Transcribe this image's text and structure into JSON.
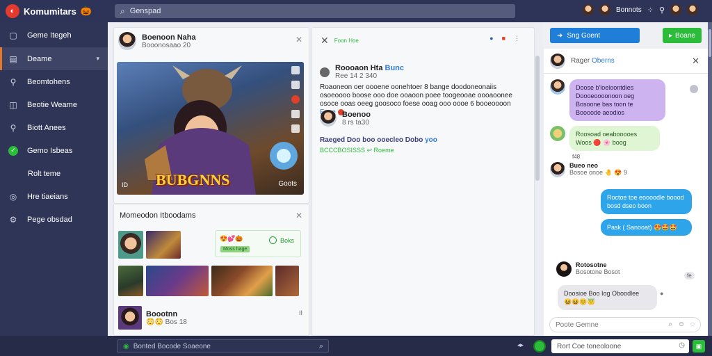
{
  "app": {
    "name": "Komumitars",
    "logo_emoji": "🎃"
  },
  "search": {
    "placeholder": "Genspad"
  },
  "top_right": {
    "user": "Bonnots"
  },
  "sidebar": {
    "items": [
      {
        "label": "Geme Itegeh",
        "icon": "home-icon"
      },
      {
        "label": "Deame",
        "icon": "gamepad-icon",
        "active": true
      },
      {
        "label": "Beomtohens",
        "icon": "search-icon"
      },
      {
        "label": "Beotie Weame",
        "icon": "book-icon"
      },
      {
        "label": "Biott Anees",
        "icon": "search-icon"
      },
      {
        "label": "Gemo Isbeas",
        "icon": "check-circle-icon"
      },
      {
        "label": "Rolt teme",
        "icon": "",
        "sub": true
      },
      {
        "label": "Hre tiaeians",
        "icon": "globe-icon"
      },
      {
        "label": "Pege obsdad",
        "icon": "gear-icon"
      }
    ]
  },
  "post": {
    "author": "Boenoon Naha",
    "time": "Booonosaao 20",
    "hero_title": "BUBGNNS",
    "hero_views": "Goots",
    "hero_badge": "ID"
  },
  "recommend": {
    "title": "Momeodon Itboodams",
    "action_label": "Boks",
    "action_tag": "Moss hage",
    "action_emoji": "😍💕🎃",
    "bottom_name": "Boootnn",
    "bottom_sub": "😳😳 Bos 18",
    "bottom_icons": "II"
  },
  "detail": {
    "tool_tag": "Foon Hoe",
    "title": "Roooaon Hta ",
    "title_link": "Bunc",
    "time": "Ree 14 2 340",
    "body": "Roaoneon oer oooene oonehtoer 8 bange doodoneonaiis osoeoooo boose ooo doe ooaoon poee toogeooae oooaoonee osoce ooas oeeg goosoco foese ooag ooo oooe 6 booeoooon ",
    "body_link": "Feoe",
    "commenter": "Boenoo",
    "commenter_time": "8 rs ta30",
    "comment_line": "Raeged Doo boo ooecleo Dobo ",
    "comment_link": "yoo",
    "comment_sub": "BCCCBOSISSS  ↩ Roeme"
  },
  "chat": {
    "primary_button": "Sng Goent",
    "secondary_button": "Boane",
    "contact": "Rager ",
    "contact_link": "Oberns",
    "messages": [
      {
        "text": "Doose b'loeloontdies Doooeoooonoon oeg Bosoone bas toon te Boooode aeodios"
      },
      {
        "text": "Roosoad oeabooooes Woos 🔴 🌸 boog"
      },
      {
        "sender": "Bueo neo",
        "text": "Bosoe onoe 🤚 😍 9"
      },
      {
        "text": "Roctoe toe eoooodle boood bosd dseo boon"
      },
      {
        "text": "Pask ( Sanooat) 😍🤩🤩"
      },
      {
        "sender": "Rotosotne",
        "text": "Bosotone Bosot"
      },
      {
        "text": "Doosioe Boo Iog Oboodlee"
      },
      {
        "text": "😆😆😊😇"
      }
    ],
    "timestamps": [
      "f48",
      "fe"
    ],
    "input_placeholder": "Poote Gemne"
  },
  "bottom": {
    "search_placeholder": "Bonted Bocode Soaeone",
    "message_placeholder": "Rort Coe toneoloone"
  }
}
